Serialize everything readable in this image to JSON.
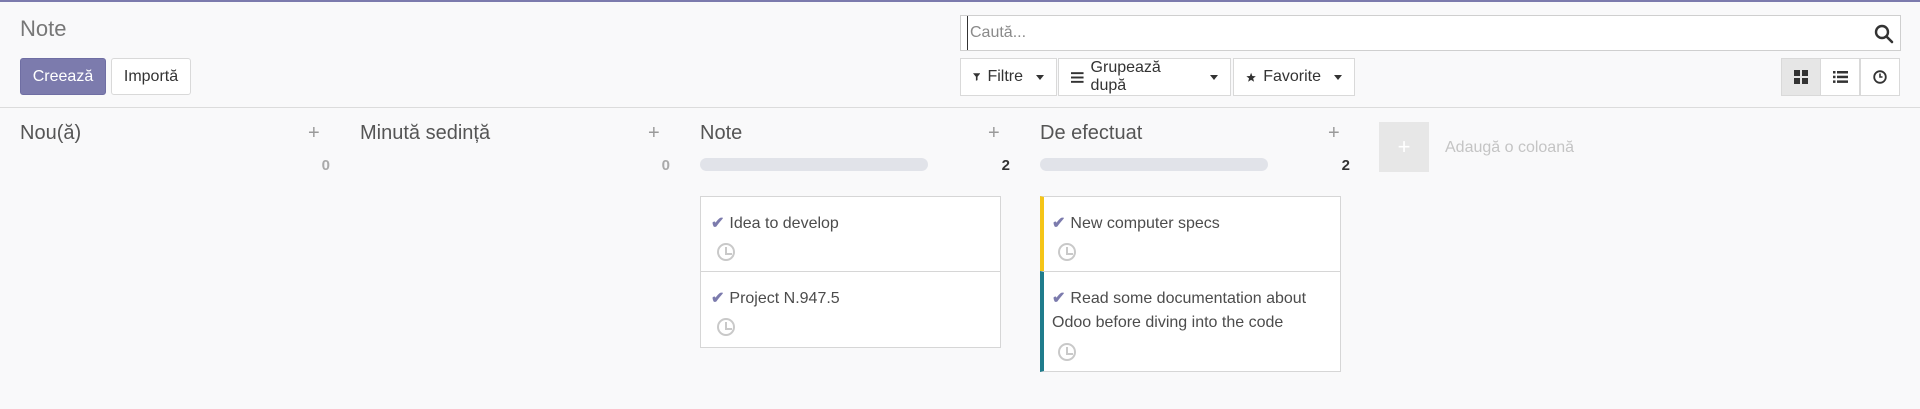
{
  "page": {
    "title": "Note",
    "accent_color": "#7c7bad"
  },
  "actions": {
    "create_label": "Creează",
    "import_label": "Importă"
  },
  "search": {
    "placeholder": "Caută...",
    "value": ""
  },
  "filters": {
    "filter_label": "Filtre",
    "group_label": "Grupează după",
    "favorites_label": "Favorite"
  },
  "views": {
    "kanban_icon": "kanban-icon",
    "list_icon": "list-icon",
    "activity_icon": "clock-icon",
    "active": "kanban"
  },
  "columns": [
    {
      "title": "Nou(ă)",
      "count": "0",
      "cards": []
    },
    {
      "title": "Minută sedință",
      "count": "0",
      "cards": []
    },
    {
      "title": "Note",
      "count": "2",
      "cards": [
        {
          "text": "Idea to develop",
          "color": ""
        },
        {
          "text": "Project N.947.5",
          "color": ""
        }
      ]
    },
    {
      "title": "De efectuat",
      "count": "2",
      "cards": [
        {
          "text": "New computer specs",
          "color": "#f5c518"
        },
        {
          "text": "Read some documentation about",
          "text2": "Odoo before diving into the code",
          "color": "#1f7c8c"
        }
      ]
    }
  ],
  "add_column": {
    "label": "Adaugă o coloană"
  }
}
